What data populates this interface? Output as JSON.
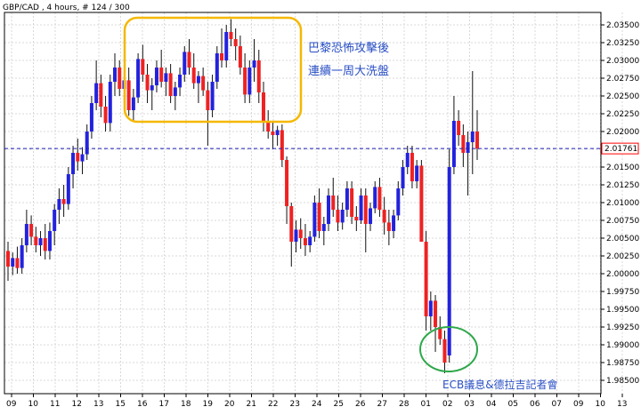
{
  "chart_data": {
    "type": "candlestick",
    "symbol_label": "GBP/CAD , 4 hours, # 124 / 300",
    "price_scale": {
      "min": 1.985,
      "max": 2.035,
      "ticks": [
        "2.03500",
        "2.03250",
        "2.03000",
        "2.02750",
        "2.02500",
        "2.02250",
        "2.02000",
        "2.01750",
        "2.01500",
        "2.01250",
        "2.01000",
        "2.00750",
        "2.00500",
        "2.00250",
        "2.00000",
        "1.99750",
        "1.99500",
        "1.99250",
        "1.99000",
        "1.98750",
        "1.98500"
      ]
    },
    "current_price": {
      "value": 2.01761,
      "label": "2.01761",
      "line_color": "#2020c0"
    },
    "x_ticks": [
      "09",
      "10",
      "11",
      "12",
      "13",
      "15",
      "16",
      "17",
      "18",
      "19",
      "20",
      "21",
      "22",
      "23",
      "24",
      "25",
      "26",
      "27",
      "28",
      "01",
      "02",
      "03",
      "04",
      "05",
      "06",
      "07",
      "09",
      "10",
      "13"
    ],
    "grid": true,
    "colors": {
      "up": "#2222dd",
      "down": "#ee2222",
      "wick": "#111111",
      "grid": "#d8d8d8"
    },
    "annotations": [
      {
        "text": "巴黎恐怖攻擊後",
        "color": "#2a4fc4"
      },
      {
        "text": "連續一周大洗盤",
        "color": "#2a4fc4"
      },
      {
        "text": "ECB議息&德拉吉記者會",
        "color": "#2a4fc4"
      }
    ],
    "highlight_shapes": [
      {
        "shape": "rounded-rect",
        "color": "#f5b800"
      },
      {
        "shape": "ellipse",
        "color": "#2ea84a"
      }
    ],
    "candles": [
      [
        2.0032,
        2.0045,
        1.999,
        2.001
      ],
      [
        2.001,
        2.003,
        1.9998,
        2.0022
      ],
      [
        2.0022,
        2.0038,
        2.0,
        2.0008
      ],
      [
        2.0008,
        2.005,
        2.0,
        2.004
      ],
      [
        2.004,
        2.009,
        2.003,
        2.007
      ],
      [
        2.007,
        2.0082,
        2.004,
        2.0052
      ],
      [
        2.0052,
        2.0066,
        2.003,
        2.004
      ],
      [
        2.004,
        2.006,
        2.0025,
        2.005
      ],
      [
        2.005,
        2.007,
        2.002,
        2.0032
      ],
      [
        2.0032,
        2.0072,
        2.002,
        2.006
      ],
      [
        2.006,
        2.0098,
        2.004,
        2.009
      ],
      [
        2.009,
        2.012,
        2.007,
        2.0105
      ],
      [
        2.0105,
        2.0125,
        2.008,
        2.0098
      ],
      [
        2.0098,
        2.015,
        2.009,
        2.014
      ],
      [
        2.014,
        2.018,
        2.012,
        2.017
      ],
      [
        2.017,
        2.019,
        2.0145,
        2.0158
      ],
      [
        2.0158,
        2.0178,
        2.014,
        2.0168
      ],
      [
        2.0168,
        2.021,
        2.016,
        2.02
      ],
      [
        2.02,
        2.025,
        2.019,
        2.024
      ],
      [
        2.024,
        2.03,
        2.023,
        2.0268
      ],
      [
        2.0268,
        2.028,
        2.022,
        2.0235
      ],
      [
        2.0235,
        2.025,
        2.02,
        2.0212
      ],
      [
        2.0212,
        2.028,
        2.02,
        2.027
      ],
      [
        2.027,
        2.031,
        2.025,
        2.029
      ],
      [
        2.029,
        2.03,
        2.025,
        2.026
      ],
      [
        2.026,
        2.0285,
        2.024,
        2.0272
      ],
      [
        2.0272,
        2.029,
        2.0222,
        2.023
      ],
      [
        2.023,
        2.026,
        2.0215,
        2.0248
      ],
      [
        2.0248,
        2.031,
        2.024,
        2.0302
      ],
      [
        2.0302,
        2.0322,
        2.027,
        2.028
      ],
      [
        2.028,
        2.0295,
        2.024,
        2.0258
      ],
      [
        2.0258,
        2.0275,
        2.023,
        2.0265
      ],
      [
        2.0265,
        2.03,
        2.0255,
        2.029
      ],
      [
        2.029,
        2.0315,
        2.0262,
        2.027
      ],
      [
        2.027,
        2.029,
        2.025,
        2.0282
      ],
      [
        2.0282,
        2.0295,
        2.024,
        2.025
      ],
      [
        2.025,
        2.027,
        2.023,
        2.0262
      ],
      [
        2.0262,
        2.029,
        2.025,
        2.028
      ],
      [
        2.028,
        2.032,
        2.027,
        2.0312
      ],
      [
        2.0312,
        2.033,
        2.028,
        2.029
      ],
      [
        2.029,
        2.031,
        2.026,
        2.0268
      ],
      [
        2.0268,
        2.0285,
        2.024,
        2.0278
      ],
      [
        2.0278,
        2.029,
        2.025,
        2.0258
      ],
      [
        2.0258,
        2.027,
        2.018,
        2.023
      ],
      [
        2.023,
        2.028,
        2.022,
        2.027
      ],
      [
        2.027,
        2.032,
        2.026,
        2.031
      ],
      [
        2.031,
        2.0345,
        2.029,
        2.03
      ],
      [
        2.03,
        2.035,
        2.029,
        2.034
      ],
      [
        2.034,
        2.0358,
        2.032,
        2.033
      ],
      [
        2.033,
        2.0345,
        2.03,
        2.032
      ],
      [
        2.032,
        2.0335,
        2.028,
        2.029
      ],
      [
        2.029,
        2.031,
        2.024,
        2.0252
      ],
      [
        2.0252,
        2.03,
        2.024,
        2.029
      ],
      [
        2.029,
        2.033,
        2.027,
        2.03
      ],
      [
        2.03,
        2.0315,
        2.024,
        2.0255
      ],
      [
        2.0255,
        2.027,
        2.02,
        2.0215
      ],
      [
        2.0215,
        2.023,
        2.019,
        2.02
      ],
      [
        2.02,
        2.0215,
        2.0175,
        2.0195
      ],
      [
        2.0195,
        2.0208,
        2.018,
        2.0202
      ],
      [
        2.0202,
        2.021,
        2.015,
        2.016
      ],
      [
        2.016,
        2.0165,
        2.007,
        2.0095
      ],
      [
        2.0095,
        2.01,
        2.001,
        2.0045
      ],
      [
        2.0045,
        2.0075,
        2.003,
        2.0062
      ],
      [
        2.0062,
        2.0078,
        2.0035,
        2.005
      ],
      [
        2.005,
        2.007,
        2.0025,
        2.004
      ],
      [
        2.004,
        2.006,
        2.003,
        2.0052
      ],
      [
        2.0052,
        2.011,
        2.0045,
        2.01
      ],
      [
        2.01,
        2.012,
        2.005,
        2.006
      ],
      [
        2.006,
        2.008,
        2.004,
        2.007
      ],
      [
        2.007,
        2.012,
        2.006,
        2.011
      ],
      [
        2.011,
        2.0135,
        2.008,
        2.009
      ],
      [
        2.009,
        2.011,
        2.006,
        2.0072
      ],
      [
        2.0072,
        2.01,
        2.0062,
        2.009
      ],
      [
        2.009,
        2.013,
        2.008,
        2.012
      ],
      [
        2.012,
        2.013,
        2.007,
        2.008
      ],
      [
        2.008,
        2.0095,
        2.006,
        2.0075
      ],
      [
        2.0075,
        2.012,
        2.007,
        2.011
      ],
      [
        2.011,
        2.012,
        2.003,
        2.007
      ],
      [
        2.007,
        2.01,
        2.006,
        2.0092
      ],
      [
        2.0092,
        2.013,
        2.0085,
        2.0122
      ],
      [
        2.0122,
        2.0135,
        2.008,
        2.009
      ],
      [
        2.009,
        2.0108,
        2.0055,
        2.0072
      ],
      [
        2.0072,
        2.009,
        2.004,
        2.006
      ],
      [
        2.006,
        2.009,
        2.005,
        2.0082
      ],
      [
        2.0082,
        2.013,
        2.0075,
        2.012
      ],
      [
        2.012,
        2.016,
        2.011,
        2.015
      ],
      [
        2.015,
        2.018,
        2.014,
        2.017
      ],
      [
        2.017,
        2.018,
        2.012,
        2.013
      ],
      [
        2.013,
        2.016,
        2.012,
        2.0152
      ],
      [
        2.0152,
        2.016,
        2.01,
        2.0045
      ],
      [
        2.0045,
        2.006,
        1.992,
        1.994
      ],
      [
        1.994,
        1.9975,
        1.992,
        1.9962
      ],
      [
        1.9962,
        1.997,
        1.989,
        1.9925
      ],
      [
        1.9925,
        1.994,
        1.99,
        1.9908
      ],
      [
        1.9908,
        1.992,
        1.986,
        1.9875
      ],
      [
        1.9885,
        2.0175,
        1.9875,
        2.015
      ],
      [
        2.015,
        2.025,
        2.014,
        2.0215
      ],
      [
        2.0215,
        2.023,
        2.018,
        2.0195
      ],
      [
        2.0195,
        2.021,
        2.015,
        2.017
      ],
      [
        2.017,
        2.02,
        2.011,
        2.0185
      ],
      [
        2.0185,
        2.0285,
        2.014,
        2.02
      ],
      [
        2.02,
        2.023,
        2.016,
        2.0176
      ]
    ]
  }
}
